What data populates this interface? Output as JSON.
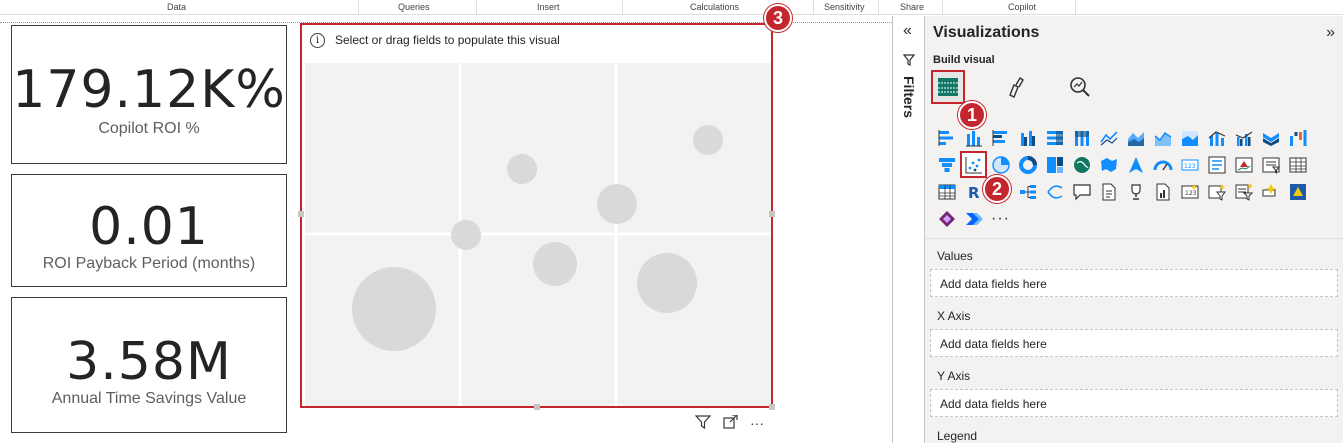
{
  "ribbon": {
    "groups": [
      "Data",
      "Queries",
      "Insert",
      "Calculations",
      "Sensitivity",
      "Share",
      "Copilot"
    ]
  },
  "cards": [
    {
      "value": "179.12K%",
      "label": "Copilot ROI %"
    },
    {
      "value": "0.01",
      "label": "ROI Payback Period (months)"
    },
    {
      "value": "3.58M",
      "label": "Annual Time Savings Value"
    }
  ],
  "visual": {
    "header_text": "Select or drag fields to populate this visual",
    "info_icon": "i",
    "more_label": "···"
  },
  "filters": {
    "label": "Filters",
    "collapse_glyph": "«"
  },
  "pane": {
    "title": "Visualizations",
    "expand_glyph": "»",
    "build_visual": "Build visual",
    "more_visuals": "···",
    "wells": [
      {
        "label": "Values",
        "placeholder": "Add data fields here"
      },
      {
        "label": "X Axis",
        "placeholder": "Add data fields here"
      },
      {
        "label": "Y Axis",
        "placeholder": "Add data fields here"
      },
      {
        "label": "Legend",
        "placeholder": ""
      }
    ]
  },
  "callouts": {
    "one": "1",
    "two": "2",
    "three": "3"
  },
  "colors": {
    "highlight": "#c4262e",
    "teal": "#118dff",
    "placeholder_bubble": "#d9d9d9"
  }
}
